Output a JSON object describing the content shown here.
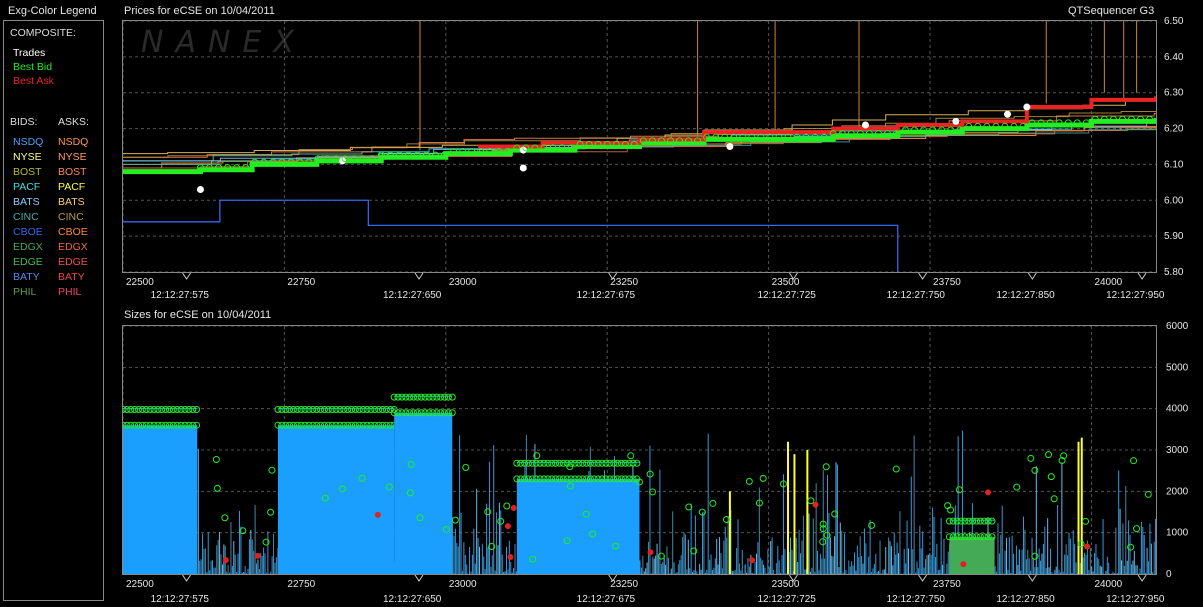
{
  "legend": {
    "title": "Exg-Color Legend",
    "composite_label": "COMPOSITE:",
    "composite": [
      {
        "label": "Trades",
        "color": "#ffffff"
      },
      {
        "label": "Best Bid",
        "color": "#22ee22"
      },
      {
        "label": "Best Ask",
        "color": "#ee2222"
      }
    ],
    "bids_label": "BIDS:",
    "asks_label": "ASKS:",
    "exchanges": [
      {
        "bid": "NSDQ",
        "ask": "NSDQ",
        "bid_color": "#4aa0ff",
        "ask_color": "#ff9944"
      },
      {
        "bid": "NYSE",
        "ask": "NYSE",
        "bid_color": "#ffff88",
        "ask_color": "#ff9966"
      },
      {
        "bid": "BOST",
        "ask": "BOST",
        "bid_color": "#bbbb33",
        "ask_color": "#ff8855"
      },
      {
        "bid": "PACF",
        "ask": "PACF",
        "bid_color": "#44dddd",
        "ask_color": "#ffff44"
      },
      {
        "bid": "BATS",
        "ask": "BATS",
        "bid_color": "#88ccff",
        "ask_color": "#ffcc66"
      },
      {
        "bid": "CINC",
        "ask": "CINC",
        "bid_color": "#44aaaa",
        "ask_color": "#bb9944"
      },
      {
        "bid": "CBOE",
        "ask": "CBOE",
        "bid_color": "#3366ee",
        "ask_color": "#ff8833"
      },
      {
        "bid": "EDGX",
        "ask": "EDGX",
        "bid_color": "#44aa66",
        "ask_color": "#ee6644"
      },
      {
        "bid": "EDGE",
        "ask": "EDGE",
        "bid_color": "#44bb55",
        "ask_color": "#ee5544"
      },
      {
        "bid": "BATY",
        "ask": "BATY",
        "bid_color": "#5588ee",
        "ask_color": "#ee4444"
      },
      {
        "bid": "PHIL",
        "ask": "PHIL",
        "bid_color": "#669944",
        "ask_color": "#ee4466"
      }
    ]
  },
  "header": {
    "prices_title": "Prices for  eCSE  on  10/04/2011",
    "app_name": "QTSequencer G3",
    "sizes_title": "Sizes for  eCSE  on  10/04/2011",
    "watermark": "NANEX"
  },
  "chart_data": [
    {
      "type": "line",
      "title": "Prices for  eCSE  on  10/04/2011",
      "xlim": [
        22500,
        24100
      ],
      "ylim": [
        5.8,
        6.5
      ],
      "y_ticks": [
        "6.50",
        "6.40",
        "6.30",
        "6.20",
        "6.10",
        "6.00",
        "5.90",
        "5.80"
      ],
      "x_ticks": [
        "22500",
        "22750",
        "23000",
        "23250",
        "23500",
        "23750",
        "24000"
      ],
      "time_labels": [
        "12:12:27:575",
        "12:12:27:650",
        "12:12:27:675",
        "12:12:27:725",
        "12:12:27:750",
        "12:12:27:850",
        "12:12:27:950"
      ],
      "grid": true,
      "series": [
        {
          "name": "Best Bid",
          "values": [
            [
              22500,
              6.08
            ],
            [
              22620,
              6.085
            ],
            [
              22700,
              6.1
            ],
            [
              22800,
              6.11
            ],
            [
              22900,
              6.12
            ],
            [
              23000,
              6.13
            ],
            [
              23100,
              6.14
            ],
            [
              23200,
              6.15
            ],
            [
              23300,
              6.16
            ],
            [
              23400,
              6.17
            ],
            [
              23500,
              6.17
            ],
            [
              23600,
              6.18
            ],
            [
              23700,
              6.19
            ],
            [
              23800,
              6.2
            ],
            [
              23900,
              6.21
            ],
            [
              24000,
              6.22
            ],
            [
              24100,
              6.23
            ]
          ]
        },
        {
          "name": "Best Ask",
          "values": [
            [
              23050,
              6.15
            ],
            [
              23150,
              6.16
            ],
            [
              23300,
              6.17
            ],
            [
              23400,
              6.19
            ],
            [
              23600,
              6.2
            ],
            [
              23700,
              6.21
            ],
            [
              23800,
              6.22
            ],
            [
              23900,
              6.26
            ],
            [
              24000,
              6.28
            ],
            [
              24100,
              6.29
            ]
          ]
        },
        {
          "name": "CBOE",
          "values": [
            [
              22500,
              5.94
            ],
            [
              22650,
              5.94
            ],
            [
              22650,
              6.0
            ],
            [
              22880,
              6.0
            ],
            [
              22880,
              5.93
            ],
            [
              23700,
              5.93
            ],
            [
              23700,
              5.8
            ]
          ]
        },
        {
          "name": "Trades",
          "values": [
            [
              22620,
              6.03
            ],
            [
              22840,
              6.11
            ],
            [
              23120,
              6.09
            ],
            [
              23120,
              6.14
            ],
            [
              23440,
              6.15
            ],
            [
              23650,
              6.21
            ],
            [
              23790,
              6.22
            ],
            [
              23870,
              6.24
            ],
            [
              23900,
              6.26
            ]
          ]
        }
      ]
    },
    {
      "type": "bar",
      "title": "Sizes for  eCSE  on  10/04/2011",
      "xlim": [
        22500,
        24100
      ],
      "ylim": [
        0,
        6000
      ],
      "y_ticks": [
        "6000",
        "5000",
        "4000",
        "3000",
        "2000",
        "1000",
        "0"
      ],
      "x_ticks": [
        "22500",
        "22750",
        "23000",
        "23250",
        "23500",
        "23750",
        "24000"
      ],
      "time_labels": [
        "12:12:27:575",
        "12:12:27:650",
        "12:12:27:675",
        "12:12:27:725",
        "12:12:27:750",
        "12:12:27:850",
        "12:12:27:950"
      ],
      "grid": true,
      "blocks": [
        {
          "name": "Best Bid",
          "x0": 22500,
          "x1": 22615,
          "y": 3600
        },
        {
          "name": "Best Bid",
          "x0": 22740,
          "x1": 22920,
          "y": 3600
        },
        {
          "name": "Best Bid",
          "x0": 22920,
          "x1": 23010,
          "y": 3900
        },
        {
          "name": "Best Bid",
          "x0": 23110,
          "x1": 23300,
          "y": 2300
        },
        {
          "name": "EDGX",
          "x0": 23780,
          "x1": 23850,
          "y": 900
        }
      ]
    }
  ]
}
